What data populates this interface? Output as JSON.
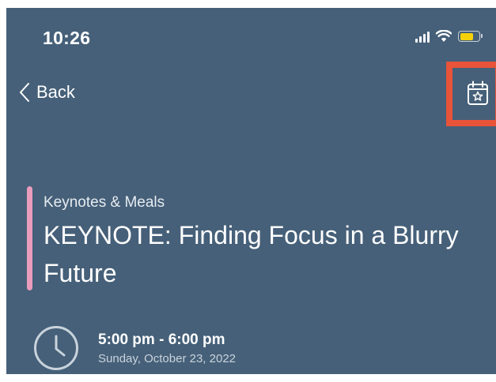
{
  "status_bar": {
    "time": "10:26"
  },
  "nav": {
    "back_label": "Back",
    "calendar_icon": "calendar-star-icon"
  },
  "event": {
    "category": "Keynotes & Meals",
    "title": "KEYNOTE: Finding Focus in a Blurry Future",
    "time_range": "5:00 pm - 6:00 pm",
    "date": "Sunday, October 23, 2022"
  },
  "colors": {
    "background": "#466079",
    "accent_bar": "#e99cbb",
    "highlight_box": "#e8533a",
    "battery": "#f5d20a"
  }
}
